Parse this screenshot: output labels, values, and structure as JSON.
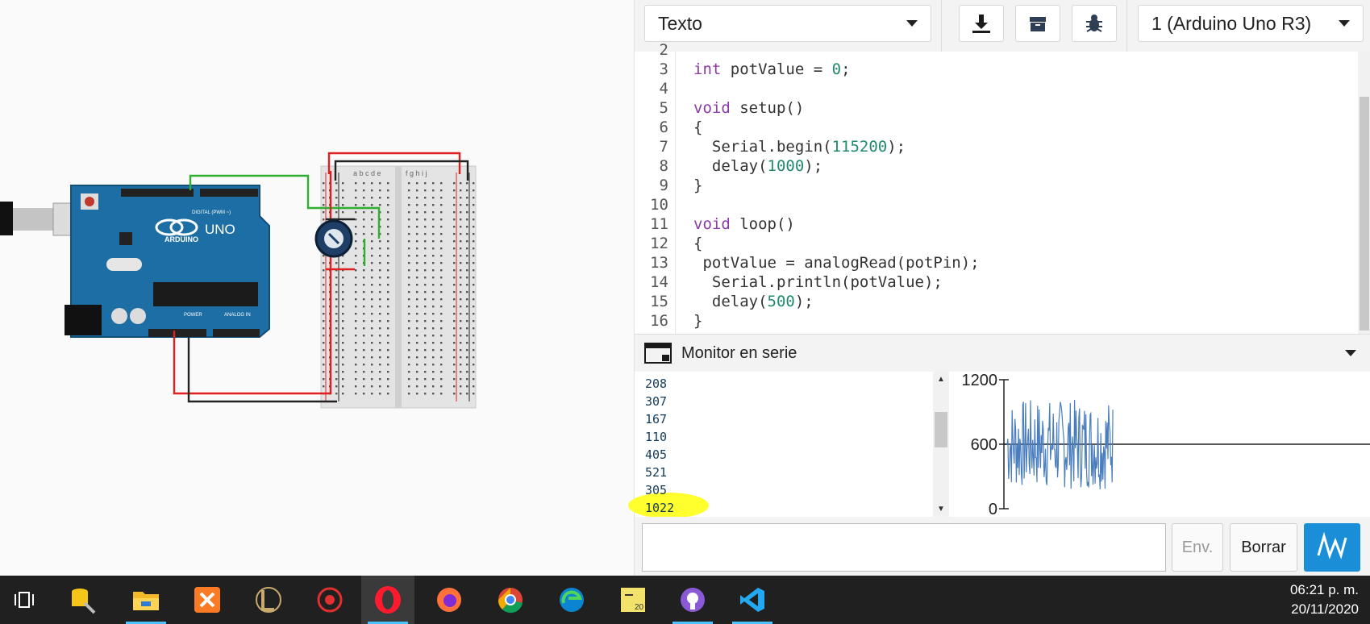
{
  "toolbar": {
    "mode_select": "Texto",
    "device_select": "1 (Arduino Uno R3)"
  },
  "editor": {
    "partial_line_number": "2",
    "lines": [
      {
        "num": "3",
        "code": "int potValue = 0;"
      },
      {
        "num": "4",
        "code": ""
      },
      {
        "num": "5",
        "code": "void setup()"
      },
      {
        "num": "6",
        "code": "{"
      },
      {
        "num": "7",
        "code": "  Serial.begin(115200);"
      },
      {
        "num": "8",
        "code": "  delay(1000);"
      },
      {
        "num": "9",
        "code": "}"
      },
      {
        "num": "10",
        "code": ""
      },
      {
        "num": "11",
        "code": "void loop()"
      },
      {
        "num": "12",
        "code": "{"
      },
      {
        "num": "13",
        "code": " potValue = analogRead(potPin);"
      },
      {
        "num": "14",
        "code": "  Serial.println(potValue);"
      },
      {
        "num": "15",
        "code": "  delay(500);"
      },
      {
        "num": "16",
        "code": "}"
      }
    ]
  },
  "monitor": {
    "title": "Monitor en serie",
    "output": [
      "208",
      "307",
      "167",
      "110",
      "405",
      "521",
      "305",
      "1022"
    ],
    "highlighted_value": "1022",
    "plot_ticks": [
      "1200",
      "600",
      "0"
    ],
    "plot_ymax": 1200
  },
  "input_row": {
    "send_label": "Env.",
    "clear_label": "Borrar"
  },
  "board": {
    "logo": "ARDUINO",
    "model": "UNO",
    "digital_label": "DIGITAL (PWM ~)",
    "power_label": "POWER",
    "analog_label": "ANALOG IN",
    "breadboard_cols_left": "a b c d e",
    "breadboard_cols_right": "f g h i j"
  },
  "taskbar": {
    "time": "06:21 p. m.",
    "date": "20/11/2020",
    "icons": [
      "task-view-icon",
      "sql-tool-icon",
      "file-explorer-icon",
      "xampp-icon",
      "league-icon",
      "gaming-app-icon",
      "opera-icon",
      "firefox-icon",
      "chrome-icon",
      "edge-icon",
      "labview-icon",
      "github-icon",
      "vscode-icon"
    ]
  },
  "colors": {
    "arduino_blue": "#1c6ea4",
    "keyword": "#8b3aa8",
    "number": "#1f8a6e",
    "plot_line": "#4a7ebf",
    "highlight": "#ffff2e",
    "plot_button": "#1a8fd8",
    "wire_red": "#e02020",
    "wire_green": "#2fae2f",
    "wire_black": "#222222"
  }
}
